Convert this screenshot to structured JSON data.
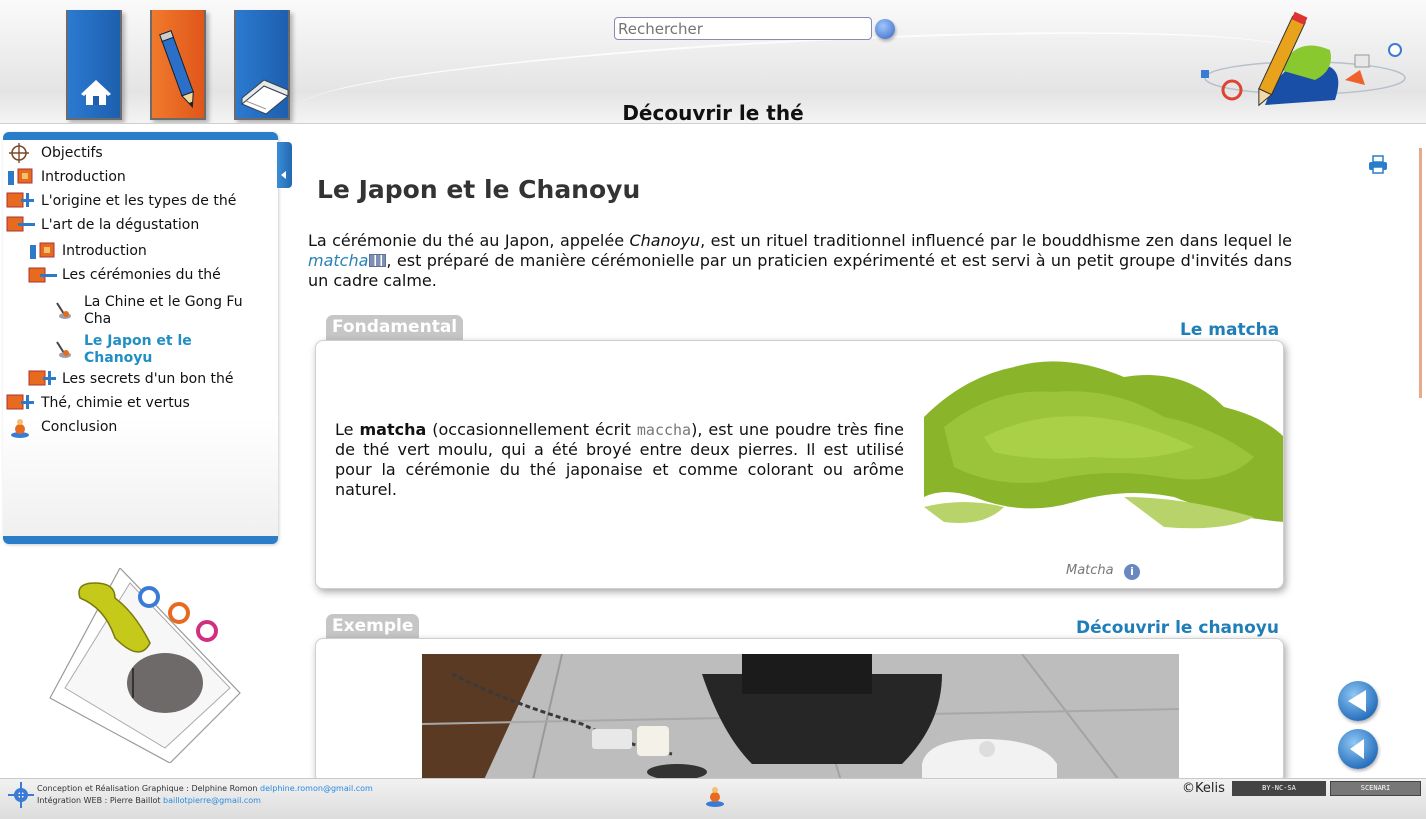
{
  "header": {
    "search_placeholder": "Rechercher",
    "site_title": "Découvrir le thé"
  },
  "nav": {
    "items": [
      {
        "label": "Objectifs"
      },
      {
        "label": "Introduction"
      },
      {
        "label": "L'origine et les types de thé"
      },
      {
        "label": "L'art de la dégustation"
      },
      {
        "label": "Introduction"
      },
      {
        "label": "Les cérémonies du thé"
      },
      {
        "label": "La Chine et le Gong Fu Cha"
      },
      {
        "label": "Le Japon et le Chanoyu"
      },
      {
        "label": "Les secrets d'un bon thé"
      },
      {
        "label": "Thé, chimie et vertus"
      },
      {
        "label": "Conclusion"
      }
    ],
    "active_index": 7
  },
  "content": {
    "title": "Le Japon et le Chanoyu",
    "intro": {
      "part1": "La cérémonie du thé au Japon, appelée ",
      "chanoyu": "Chanoyu",
      "part2": ", est un rituel traditionnel influencé par le bouddhisme zen dans lequel le ",
      "matcha_link": "matcha",
      "part3": ", est préparé de manière cérémonielle par un praticien expérimenté et est servi à un petit groupe d'invités dans un cadre calme."
    },
    "fondamental": {
      "tab": "Fondamental",
      "title": "Le matcha",
      "text_before": "Le ",
      "bold": "matcha",
      "text_mid": " (occasionnellement écrit ",
      "alt_spelling": "maccha",
      "text_after": "), est une poudre très fine de thé vert moulu, qui a été broyé entre deux pierres. Il est utilisé pour la cérémonie du thé japonaise et comme colorant ou arôme naturel.",
      "caption": "Matcha",
      "info": "i"
    },
    "exemple": {
      "tab": "Exemple",
      "title": "Découvrir le chanoyu"
    }
  },
  "footer": {
    "credits_line1": "Conception et Réalisation Graphique : Delphine Romon",
    "mail1": "delphine.romon@gmail.com",
    "credits_line2": "Intégration WEB : Pierre Baillot",
    "mail2": "baillotpierre@gmail.com",
    "kelis": "©Kelis",
    "cc_badge": "BY-NC-SA",
    "scenari_badge": "SCENARI"
  },
  "colors": {
    "accent_blue": "#2a7dc8",
    "link_blue": "#1f7db8",
    "orange": "#e0561a",
    "tab_grey": "#c6c6c6"
  }
}
